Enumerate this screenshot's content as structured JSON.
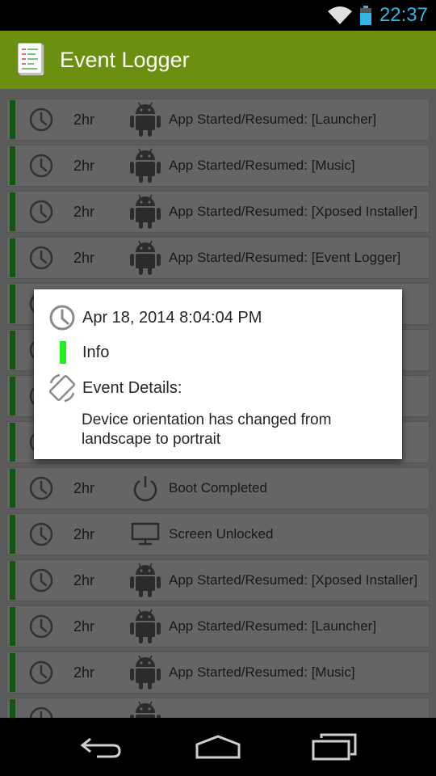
{
  "status": {
    "time": "22:37"
  },
  "app": {
    "title": "Event Logger"
  },
  "events": [
    {
      "age": "2hr",
      "icon": "android-icon",
      "description": "App Started/Resumed: [Launcher]"
    },
    {
      "age": "2hr",
      "icon": "android-icon",
      "description": "App Started/Resumed: [Music]"
    },
    {
      "age": "2hr",
      "icon": "android-icon",
      "description": "App Started/Resumed: [Xposed Installer]"
    },
    {
      "age": "2hr",
      "icon": "android-icon",
      "description": "App Started/Resumed: [Event Logger]"
    },
    {
      "age": "",
      "icon": "",
      "description": ""
    },
    {
      "age": "",
      "icon": "",
      "description": ""
    },
    {
      "age": "",
      "icon": "",
      "description": ""
    },
    {
      "age": "",
      "icon": "",
      "description": ""
    },
    {
      "age": "2hr",
      "icon": "power-icon",
      "description": "Boot Completed"
    },
    {
      "age": "2hr",
      "icon": "monitor-icon",
      "description": "Screen Unlocked"
    },
    {
      "age": "2hr",
      "icon": "android-icon",
      "description": "App Started/Resumed: [Xposed Installer]"
    },
    {
      "age": "2hr",
      "icon": "android-icon",
      "description": "App Started/Resumed: [Launcher]"
    },
    {
      "age": "2hr",
      "icon": "android-icon",
      "description": "App Started/Resumed: [Music]"
    },
    {
      "age": "",
      "icon": "android-icon",
      "description": ""
    }
  ],
  "dialog": {
    "timestamp": "Apr 18, 2014 8:04:04 PM",
    "level": "Info",
    "details_label": "Event Details:",
    "details_text": "Device orientation has changed from landscape to portrait"
  },
  "colors": {
    "action_bar": "#6b8f0f",
    "level_info": "#2ecc2e",
    "status_time": "#33b5e5"
  }
}
